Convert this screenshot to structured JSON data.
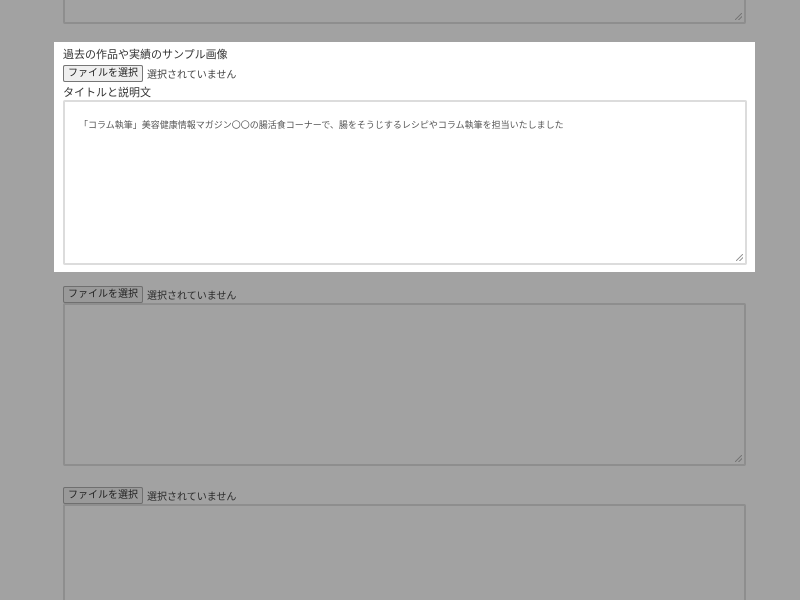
{
  "sample_section": {
    "label": "過去の作品や実績のサンプル画像",
    "file_button_label": "ファイルを選択",
    "file_status": "選択されていません",
    "description_label": "タイトルと説明文",
    "description_value": "「コラム執筆」美容健康情報マガジン〇〇の腸活食コーナーで、腸をそうじするレシピやコラム執筆を担当いたしました"
  },
  "uploads": [
    {
      "file_button_label": "ファイルを選択",
      "file_status": "選択されていません"
    },
    {
      "file_button_label": "ファイルを選択",
      "file_status": "選択されていません"
    }
  ]
}
